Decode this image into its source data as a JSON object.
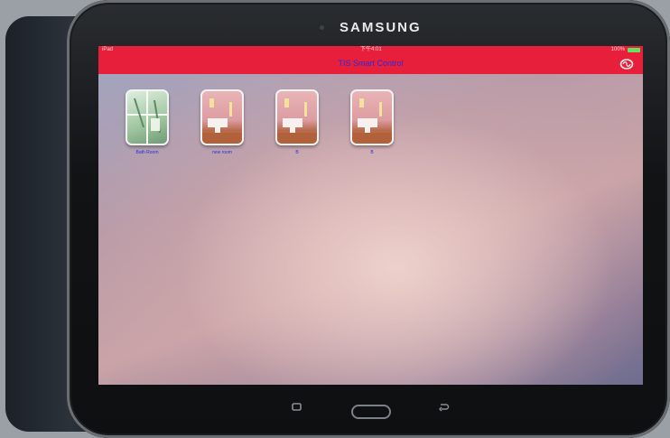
{
  "device": {
    "brand": "SAMSUNG"
  },
  "status_bar": {
    "carrier": "iPad",
    "time": "下午4:01",
    "battery": "100%"
  },
  "nav": {
    "title": "TIS Smart Control"
  },
  "rooms": [
    {
      "label": "Bath Room",
      "style": "bath"
    },
    {
      "label": "new room",
      "style": "pink"
    },
    {
      "label": "B",
      "style": "pink"
    },
    {
      "label": "B",
      "style": "pink"
    }
  ],
  "colors": {
    "nav_red": "#e81f3a",
    "label_blue": "#2a2ae0"
  }
}
